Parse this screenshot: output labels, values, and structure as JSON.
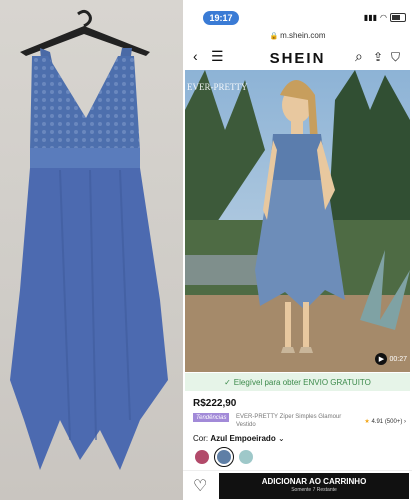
{
  "statusbar": {
    "time": "19:17",
    "url": "m.shein.com"
  },
  "header": {
    "logo": "SHEIN",
    "back_icon": "chevron-left-icon",
    "menu_icon": "menu-icon",
    "search_icon": "search-icon",
    "share_icon": "share-icon",
    "cart_icon": "bag-icon"
  },
  "hero": {
    "brand_watermark": "EVER-PRETTY",
    "video_time": "00:27"
  },
  "shipping": {
    "text": "Elegível para obter ENVIO GRATUITO"
  },
  "product": {
    "price": "R$222,90",
    "tag": "Tendências",
    "title": "EVER-PRETTY Zíper Simples Glamour Vestido",
    "rating": "4.91 (500+)",
    "color_label": "Cor:",
    "color_value": "Azul Empoeirado",
    "swatches": [
      {
        "name": "burgundy",
        "color": "#b24a6a"
      },
      {
        "name": "dusty-blue",
        "color": "#5f7fa6"
      },
      {
        "name": "mint",
        "color": "#9ec8c9"
      }
    ]
  },
  "actions": {
    "add_to_cart": "ADICIONAR AO CARRINHO",
    "stock_note": "Somente 7 Restante"
  },
  "colors": {
    "accent_blue": "#3a7bd5",
    "shipping_green": "#3c8a4b",
    "tag_purple": "#a28ad8"
  }
}
